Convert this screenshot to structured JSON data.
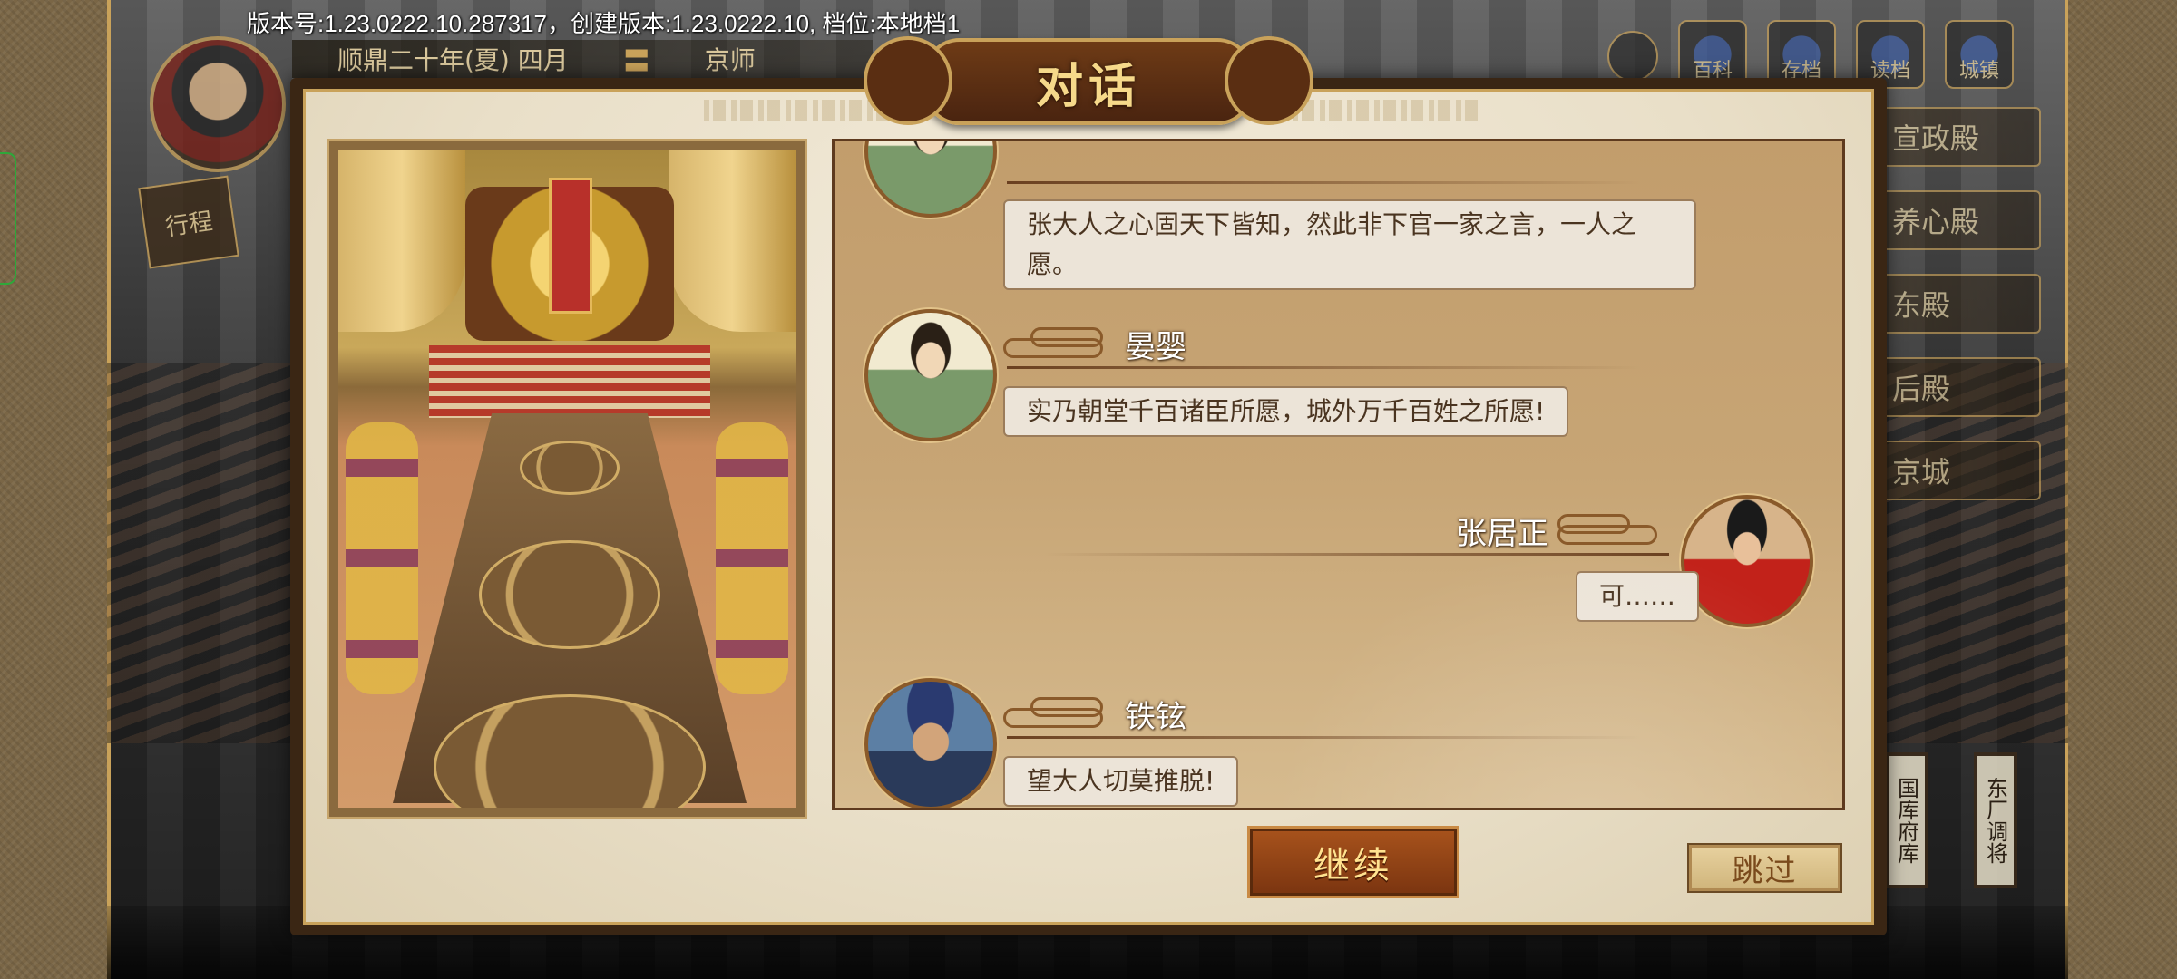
{
  "header": {
    "version_text": "版本号:1.23.0222.10.287317，创建版本:1.23.0222.10, 档位:本地档1",
    "date": "顺鼎二十年(夏) 四月",
    "location": "京师"
  },
  "top_icons": [
    {
      "name": "history-icon",
      "label": ""
    },
    {
      "name": "records-icon",
      "label": "百科"
    },
    {
      "name": "save-icon",
      "label": "存档"
    },
    {
      "name": "load-icon",
      "label": "读档"
    },
    {
      "name": "city-icon",
      "label": "城镇"
    }
  ],
  "right_nav": [
    "宣政殿",
    "养心殿",
    "东殿",
    "后殿",
    "京城"
  ],
  "bottom_signs": [
    "国库府库",
    "东厂调将"
  ],
  "side_badge": "行程",
  "dialog": {
    "title": "对话",
    "messages": [
      {
        "speaker": "晏婴",
        "text": "张大人之心固天下皆知，然此非下官一家之言，一人之愿。"
      },
      {
        "speaker": "晏婴",
        "text": "实乃朝堂千百诸臣所愿，城外万千百姓之所愿!"
      },
      {
        "speaker": "张居正",
        "text": "可……"
      },
      {
        "speaker": "铁铉",
        "text": "望大人切莫推脱!"
      }
    ],
    "continue_label": "继续",
    "skip_label": "跳过"
  },
  "colors": {
    "accent_gold": "#c9a25a",
    "title_text": "#f6d98a",
    "continue_bg": "#8e4214",
    "bubble_bg": "#ece4d8"
  }
}
